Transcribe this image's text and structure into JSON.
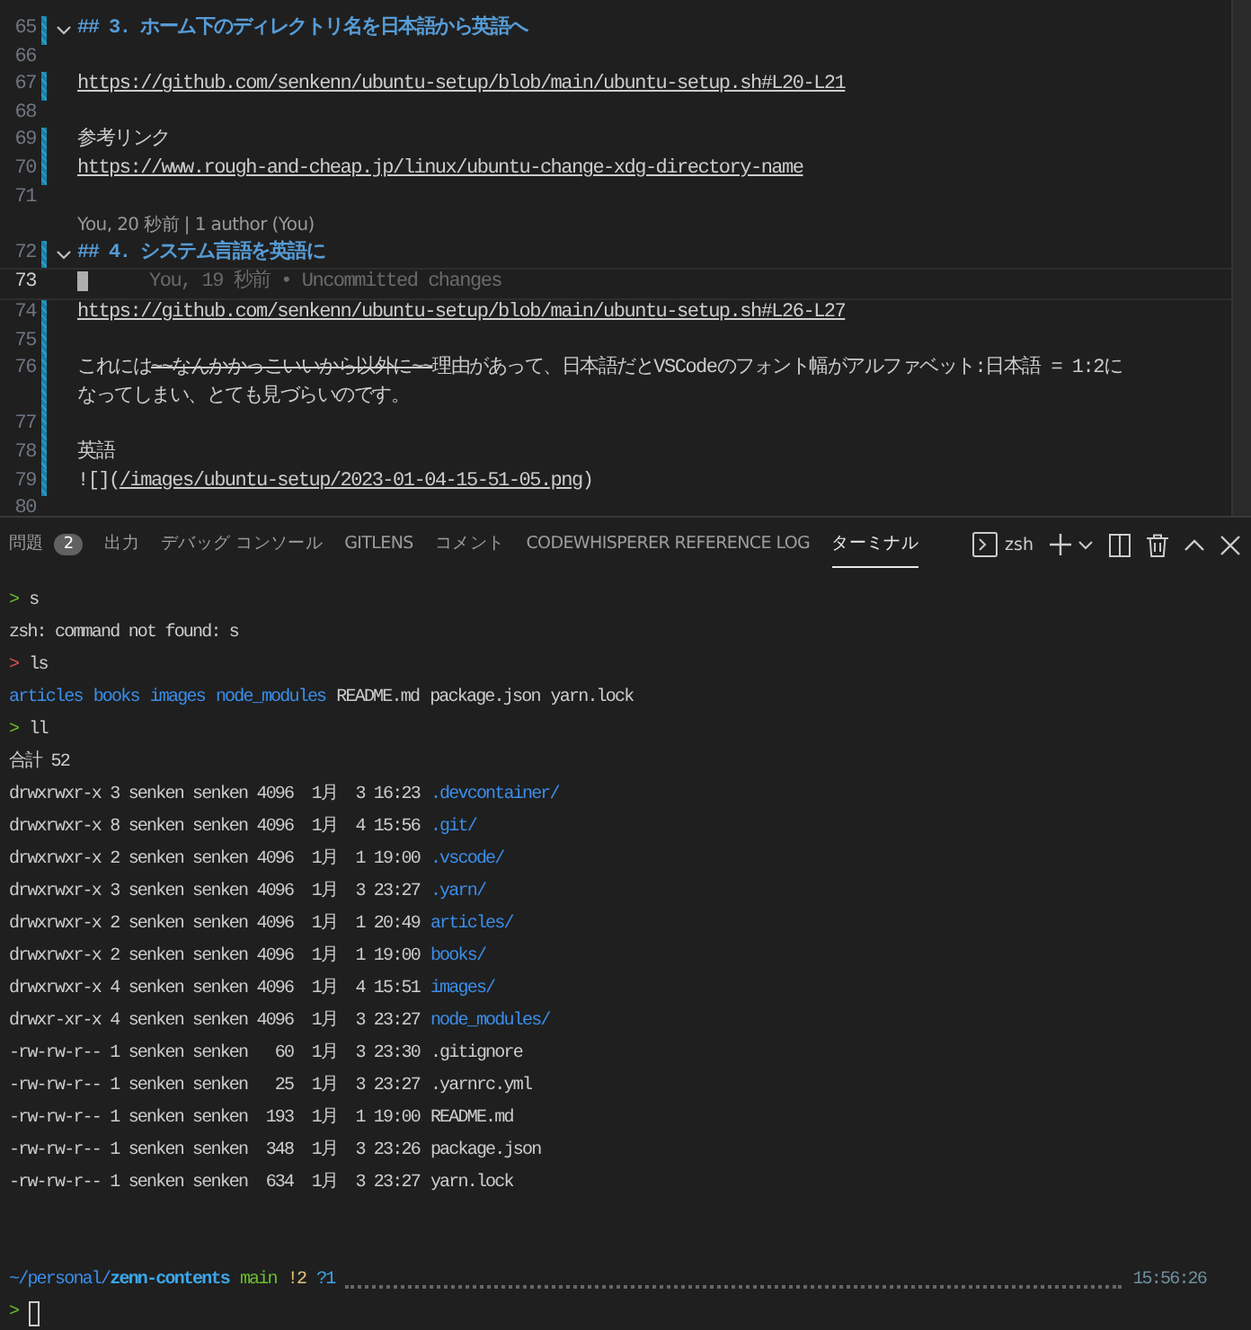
{
  "editor": {
    "lines": [
      {
        "number": "65",
        "kind": "heading",
        "changed": true,
        "text": "## 3. ホーム下のディレクトリ名を日本語から英語へ"
      },
      {
        "number": "66",
        "kind": "blank",
        "changed": false
      },
      {
        "number": "67",
        "kind": "link",
        "changed": true,
        "text": "https://github.com/senkenn/ubuntu-setup/blob/main/ubuntu-setup.sh#L20-L21"
      },
      {
        "number": "68",
        "kind": "blank",
        "changed": false
      },
      {
        "number": "69",
        "kind": "text",
        "changed": true,
        "text": "参考リンク"
      },
      {
        "number": "70",
        "kind": "link",
        "changed": true,
        "text": "https://www.rough-and-cheap.jp/linux/ubuntu-change-xdg-directory-name"
      },
      {
        "number": "71",
        "kind": "blank",
        "changed": false
      },
      {
        "kind": "codelens",
        "text": "You, 20 秒前 | 1 author (You)"
      },
      {
        "number": "72",
        "kind": "heading",
        "changed": true,
        "text": "## 4. システム言語を英語に"
      },
      {
        "number": "73",
        "kind": "current",
        "changed": false,
        "blame": "You, 19 秒前 • Uncommitted changes"
      },
      {
        "number": "74",
        "kind": "link",
        "changed": true,
        "text": "https://github.com/senkenn/ubuntu-setup/blob/main/ubuntu-setup.sh#L26-L27"
      },
      {
        "number": "75",
        "kind": "blank",
        "changed": true
      },
      {
        "number": "76",
        "kind": "mixed",
        "changed": true,
        "segments": [
          {
            "kind": "plain",
            "text": "これには"
          },
          {
            "kind": "strike",
            "text": "~~なんかかっこいいから以外に~~"
          },
          {
            "kind": "plain",
            "text": "理由があって、日本語だとVSCodeのフォント幅がアルファベット:日本語 = 1:2になってしまい、とても見づらいのです。"
          }
        ]
      },
      {
        "number": "77",
        "kind": "blank",
        "changed": true
      },
      {
        "number": "78",
        "kind": "text",
        "changed": true,
        "text": "英語"
      },
      {
        "number": "79",
        "kind": "mixed",
        "changed": true,
        "segments": [
          {
            "kind": "plain",
            "text": "![]("
          },
          {
            "kind": "link",
            "text": "/images/ubuntu-setup/2023-01-04-15-51-05.png"
          },
          {
            "kind": "plain",
            "text": ")"
          }
        ]
      },
      {
        "number": "80",
        "kind": "blank",
        "changed": false
      }
    ]
  },
  "panel": {
    "tabs": [
      {
        "label": "問題",
        "badge": "2",
        "selected": false
      },
      {
        "label": "出力",
        "selected": false
      },
      {
        "label": "デバッグ コンソール",
        "selected": false
      },
      {
        "label": "GITLENS",
        "selected": false
      },
      {
        "label": "コメント",
        "selected": false
      },
      {
        "label": "CODEWHISPERER REFERENCE LOG",
        "selected": false
      },
      {
        "label": "ターミナル",
        "selected": true
      }
    ],
    "shell": "zsh"
  },
  "terminal": [
    {
      "kind": "prompt",
      "failed": false,
      "arrow": ">",
      "command": "s"
    },
    {
      "kind": "output",
      "text": "zsh: command not found: s"
    },
    {
      "kind": "prompt",
      "failed": true,
      "arrow": ">",
      "command": "ls"
    },
    {
      "kind": "files",
      "items": [
        {
          "name": "articles",
          "dir": true
        },
        {
          "name": "books",
          "dir": true
        },
        {
          "name": "images",
          "dir": true
        },
        {
          "name": "node_modules",
          "dir": true
        },
        {
          "name": "README.md",
          "dir": false
        },
        {
          "name": "package.json",
          "dir": false
        },
        {
          "name": "yarn.lock",
          "dir": false
        }
      ]
    },
    {
      "kind": "prompt",
      "failed": false,
      "arrow": ">",
      "command": "ll"
    },
    {
      "kind": "output",
      "text": "合計 52"
    },
    {
      "kind": "entry",
      "info": "drwxrwxr-x 3 senken senken 4096  1月  3 16:23",
      "name": ".devcontainer/",
      "dir": true
    },
    {
      "kind": "entry",
      "info": "drwxrwxr-x 8 senken senken 4096  1月  4 15:56",
      "name": ".git/",
      "dir": true
    },
    {
      "kind": "entry",
      "info": "drwxrwxr-x 2 senken senken 4096  1月  1 19:00",
      "name": ".vscode/",
      "dir": true
    },
    {
      "kind": "entry",
      "info": "drwxrwxr-x 3 senken senken 4096  1月  3 23:27",
      "name": ".yarn/",
      "dir": true
    },
    {
      "kind": "entry",
      "info": "drwxrwxr-x 2 senken senken 4096  1月  1 20:49",
      "name": "articles/",
      "dir": true
    },
    {
      "kind": "entry",
      "info": "drwxrwxr-x 2 senken senken 4096  1月  1 19:00",
      "name": "books/",
      "dir": true
    },
    {
      "kind": "entry",
      "info": "drwxrwxr-x 4 senken senken 4096  1月  4 15:51",
      "name": "images/",
      "dir": true
    },
    {
      "kind": "entry",
      "info": "drwxr-xr-x 4 senken senken 4096  1月  3 23:27",
      "name": "node_modules/",
      "dir": true
    },
    {
      "kind": "entry",
      "info": "-rw-rw-r-- 1 senken senken   60  1月  3 23:30",
      "name": ".gitignore",
      "dir": false
    },
    {
      "kind": "entry",
      "info": "-rw-rw-r-- 1 senken senken   25  1月  3 23:27",
      "name": ".yarnrc.yml",
      "dir": false
    },
    {
      "kind": "entry",
      "info": "-rw-rw-r-- 1 senken senken  193  1月  1 19:00",
      "name": "README.md",
      "dir": false
    },
    {
      "kind": "entry",
      "info": "-rw-rw-r-- 1 senken senken  348  1月  3 23:26",
      "name": "package.json",
      "dir": false
    },
    {
      "kind": "entry",
      "info": "-rw-rw-r-- 1 senken senken  634  1月  3 23:27",
      "name": "yarn.lock",
      "dir": false
    },
    {
      "kind": "blank"
    },
    {
      "kind": "blank"
    },
    {
      "kind": "status",
      "path": "~/personal/",
      "repo": "zenn-contents",
      "branch": "main",
      "modified": "!2",
      "untracked": "?1",
      "time": "15:56:26"
    },
    {
      "kind": "input",
      "failed": false,
      "arrow": ">"
    }
  ]
}
